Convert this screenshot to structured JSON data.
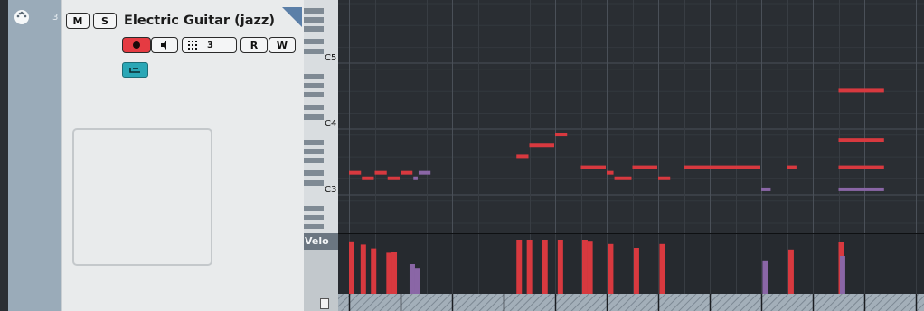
{
  "track": {
    "number": "3",
    "name": "Electric Guitar (jazz)",
    "mute_label": "M",
    "solo_label": "S",
    "channel_value": "3",
    "read_label": "R",
    "write_label": "W"
  },
  "keyboard": {
    "octave_labels": [
      "C5",
      "C4",
      "C3"
    ]
  },
  "controller_lane": {
    "label": "Velo"
  },
  "colors": {
    "note_red": "#d8393f",
    "note_purple": "#8a66a6",
    "record_active": "#e53b42",
    "edit_button": "#2aa7b6",
    "grid_bg": "#2a2e33"
  },
  "notes": [
    {
      "pitch": 52,
      "start": 0.0,
      "end": 0.5,
      "color": "red"
    },
    {
      "pitch": 51,
      "start": 0.5,
      "end": 1.0,
      "color": "red"
    },
    {
      "pitch": 52,
      "start": 1.0,
      "end": 1.5,
      "color": "red"
    },
    {
      "pitch": 51,
      "start": 1.5,
      "end": 2.0,
      "color": "red"
    },
    {
      "pitch": 52,
      "start": 2.0,
      "end": 2.5,
      "color": "red"
    },
    {
      "pitch": 51,
      "start": 2.5,
      "end": 2.7,
      "color": "purple"
    },
    {
      "pitch": 52,
      "start": 2.7,
      "end": 3.2,
      "color": "purple"
    },
    {
      "pitch": 55,
      "start": 6.5,
      "end": 7.0,
      "color": "red"
    },
    {
      "pitch": 57,
      "start": 7.0,
      "end": 8.0,
      "color": "red"
    },
    {
      "pitch": 59,
      "start": 8.0,
      "end": 8.5,
      "color": "red"
    },
    {
      "pitch": 53,
      "start": 9.0,
      "end": 10.0,
      "color": "red"
    },
    {
      "pitch": 52,
      "start": 10.0,
      "end": 10.3,
      "color": "red"
    },
    {
      "pitch": 51,
      "start": 10.3,
      "end": 11.0,
      "color": "red"
    },
    {
      "pitch": 53,
      "start": 11.0,
      "end": 12.0,
      "color": "red"
    },
    {
      "pitch": 51,
      "start": 12.0,
      "end": 12.5,
      "color": "red"
    },
    {
      "pitch": 53,
      "start": 13.0,
      "end": 16.0,
      "color": "red"
    },
    {
      "pitch": 49,
      "start": 16.0,
      "end": 16.4,
      "color": "purple"
    },
    {
      "pitch": 53,
      "start": 17.0,
      "end": 17.4,
      "color": "red"
    },
    {
      "pitch": 53,
      "start": 19.0,
      "end": 20.8,
      "color": "red"
    },
    {
      "pitch": 49,
      "start": 19.0,
      "end": 20.8,
      "color": "purple"
    },
    {
      "pitch": 58,
      "start": 19.0,
      "end": 20.8,
      "color": "red"
    },
    {
      "pitch": 67,
      "start": 19.0,
      "end": 20.8,
      "color": "red"
    }
  ],
  "velocities": [
    {
      "pos": 0.0,
      "vel": 0.97,
      "color": "red"
    },
    {
      "pos": 0.45,
      "vel": 0.91,
      "color": "red"
    },
    {
      "pos": 0.85,
      "vel": 0.84,
      "color": "red"
    },
    {
      "pos": 1.45,
      "vel": 0.76,
      "color": "red"
    },
    {
      "pos": 1.65,
      "vel": 0.77,
      "color": "red"
    },
    {
      "pos": 2.35,
      "vel": 0.55,
      "color": "purple"
    },
    {
      "pos": 2.55,
      "vel": 0.48,
      "color": "purple"
    },
    {
      "pos": 6.5,
      "vel": 1.0,
      "color": "red"
    },
    {
      "pos": 6.9,
      "vel": 1.0,
      "color": "red"
    },
    {
      "pos": 7.5,
      "vel": 1.0,
      "color": "red"
    },
    {
      "pos": 8.1,
      "vel": 1.0,
      "color": "red"
    },
    {
      "pos": 9.05,
      "vel": 1.0,
      "color": "red"
    },
    {
      "pos": 9.25,
      "vel": 0.98,
      "color": "red"
    },
    {
      "pos": 10.05,
      "vel": 0.92,
      "color": "red"
    },
    {
      "pos": 11.05,
      "vel": 0.85,
      "color": "red"
    },
    {
      "pos": 12.05,
      "vel": 0.92,
      "color": "red"
    },
    {
      "pos": 16.05,
      "vel": 0.62,
      "color": "purple"
    },
    {
      "pos": 17.05,
      "vel": 0.82,
      "color": "red"
    },
    {
      "pos": 19.0,
      "vel": 0.95,
      "color": "red"
    },
    {
      "pos": 19.05,
      "vel": 0.7,
      "color": "purple"
    }
  ]
}
